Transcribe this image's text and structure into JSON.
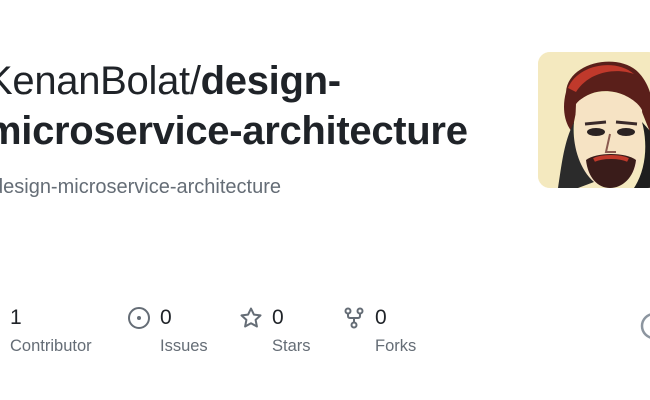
{
  "repo": {
    "owner": "KenanBolat/",
    "name_line1": "design-",
    "name_line2": "microservice-architecture",
    "description": "design-microservice-architecture"
  },
  "avatar": {
    "icon": "user-avatar"
  },
  "stats": [
    {
      "icon": "people-icon",
      "value": "1",
      "label": "Contributor"
    },
    {
      "icon": "issue-icon",
      "value": "0",
      "label": "Issues"
    },
    {
      "icon": "star-icon",
      "value": "0",
      "label": "Stars"
    },
    {
      "icon": "fork-icon",
      "value": "0",
      "label": "Forks"
    }
  ],
  "colors": {
    "text": "#1f2328",
    "muted": "#656d76",
    "icon": "#656d76"
  }
}
